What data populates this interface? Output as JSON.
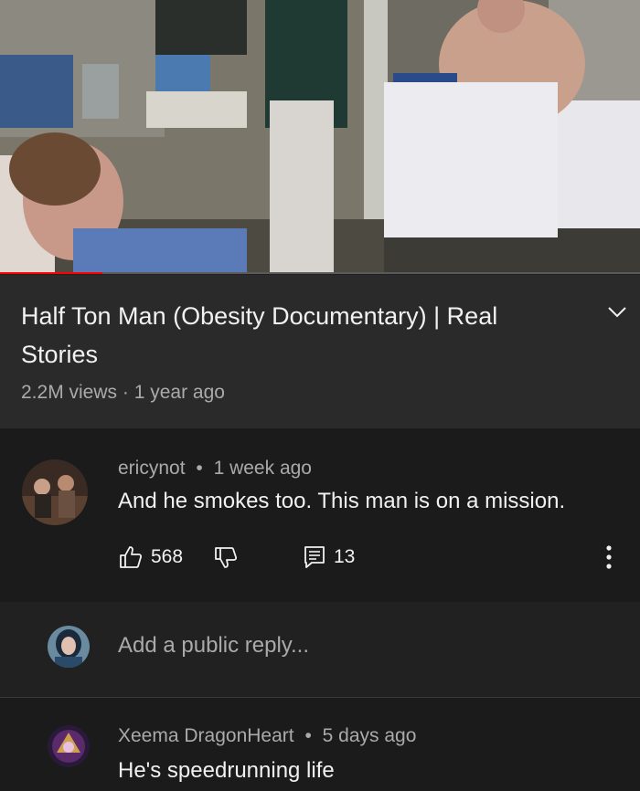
{
  "video": {
    "progress": 0.16
  },
  "title_section": {
    "title": "Half Ton Man (Obesity Documentary) | Real Stories",
    "views": "2.2M views",
    "separator": "·",
    "age": "1 year ago",
    "expand_icon": "chevron-down-icon"
  },
  "comments": [
    {
      "author": "ericynot",
      "separator": "•",
      "time": "1 week ago",
      "text": "And he smokes too. This man is on a mission.",
      "likes": "568",
      "replies": "13",
      "icons": {
        "like": "thumb-up-icon",
        "dislike": "thumb-down-icon",
        "reply": "comment-icon",
        "more": "more-vertical-icon"
      }
    },
    {
      "author": "Xeema DragonHeart",
      "separator": "•",
      "time": "5 days ago",
      "text": "He's speedrunning life"
    }
  ],
  "reply_box": {
    "placeholder": "Add a public reply..."
  },
  "colors": {
    "background": "#212121",
    "title_section": "#2a2a2a",
    "comment_bg": "#1b1b1b",
    "secondary_text": "#aaaaaa",
    "progress": "#ff0000"
  }
}
